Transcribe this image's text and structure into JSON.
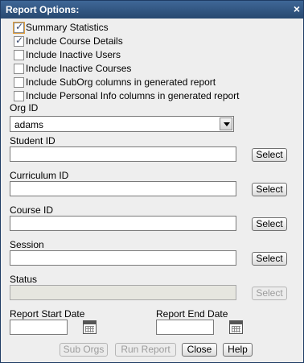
{
  "window": {
    "title": "Report Options:",
    "close_glyph": "×"
  },
  "options": [
    {
      "label": "Summary Statistics",
      "checked": true
    },
    {
      "label": "Include Course Details",
      "checked": true
    },
    {
      "label": "Include Inactive Users",
      "checked": false
    },
    {
      "label": "Include Inactive Courses",
      "checked": false
    },
    {
      "label": "Include SubOrg columns in generated report",
      "checked": false
    },
    {
      "label": "Include Personal Info columns in generated report",
      "checked": false
    }
  ],
  "org": {
    "label": "Org ID",
    "value": "adams"
  },
  "fields": {
    "student": {
      "label": "Student ID",
      "value": "",
      "button": "Select"
    },
    "curriculum": {
      "label": "Curriculum ID",
      "value": "",
      "button": "Select"
    },
    "course": {
      "label": "Course ID",
      "value": "",
      "button": "Select"
    },
    "session": {
      "label": "Session",
      "value": "",
      "button": "Select"
    },
    "status": {
      "label": "Status",
      "value": "",
      "button": "Select"
    }
  },
  "dates": {
    "start_label": "Report Start Date",
    "end_label": "Report End Date",
    "start_value": "",
    "end_value": ""
  },
  "actions": {
    "sub_orgs": "Sub Orgs",
    "run_report": "Run Report",
    "close": "Close",
    "help": "Help"
  }
}
